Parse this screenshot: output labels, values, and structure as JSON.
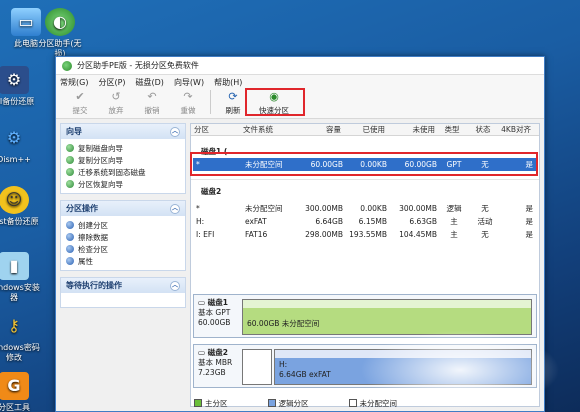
{
  "desktop": {
    "icons": [
      {
        "label": "此电脑",
        "icon": "computer-icon"
      },
      {
        "label": "分区助手(无损)",
        "icon": "partition-assistant-icon"
      },
      {
        "label": "GI备份还原",
        "icon": "ghost-backup-icon"
      },
      {
        "label": "Dism++",
        "icon": "dism-icon"
      },
      {
        "label": "host备份还原",
        "icon": "ghost-icon"
      },
      {
        "label": "Windows安装器",
        "icon": "windows-installer-icon"
      },
      {
        "label": "Windows密码修改",
        "icon": "key-icon"
      },
      {
        "label": "分区工具",
        "icon": "diskgenius-icon"
      }
    ]
  },
  "window": {
    "title": "分区助手PE版 - 无损分区免费软件",
    "menu": [
      "常规(G)",
      "分区(P)",
      "磁盘(D)",
      "向导(W)",
      "帮助(H)"
    ],
    "toolbar": [
      {
        "label": "提交",
        "icon": "check-icon",
        "enabled": false
      },
      {
        "label": "放弃",
        "icon": "undo-icon",
        "enabled": false
      },
      {
        "label": "撤销",
        "icon": "back-icon",
        "enabled": false
      },
      {
        "label": "重做",
        "icon": "redo-icon",
        "enabled": false
      },
      {
        "label": "刷新",
        "icon": "refresh-icon",
        "enabled": true
      },
      {
        "label": "快速分区",
        "icon": "quick-partition-icon",
        "enabled": true
      }
    ]
  },
  "left": {
    "wizard": {
      "title": "向导",
      "items": [
        "复制磁盘向导",
        "复制分区向导",
        "迁移系统到固态磁盘",
        "分区恢复向导"
      ]
    },
    "ops": {
      "title": "分区操作",
      "items": [
        "创建分区",
        "擦除数据",
        "检查分区",
        "属性"
      ]
    },
    "pending": {
      "title": "等待执行的操作"
    }
  },
  "table": {
    "headers": [
      "分区",
      "文件系统",
      "容量",
      "已使用",
      "未使用",
      "类型",
      "状态",
      "4KB对齐"
    ],
    "disk1": {
      "title": "磁盘1 (...",
      "rows": [
        [
          "*",
          "未分配空间",
          "60.00GB",
          "0.00KB",
          "60.00GB",
          "GPT",
          "无",
          "是"
        ]
      ]
    },
    "disk2": {
      "title": "磁盘2",
      "rows": [
        [
          "*",
          "未分配空间",
          "300.00MB",
          "0.00KB",
          "300.00MB",
          "逻辑",
          "无",
          "是"
        ],
        [
          "H:",
          "exFAT",
          "6.64GB",
          "6.15MB",
          "6.63GB",
          "主",
          "活动",
          "是"
        ],
        [
          "I: EFI",
          "FAT16",
          "298.00MB",
          "193.55MB",
          "104.45MB",
          "主",
          "无",
          "是"
        ]
      ]
    }
  },
  "diskmap": {
    "disk1": {
      "name": "磁盘1",
      "type": "基本 GPT",
      "size": "60.00GB",
      "bar": "60.00GB 未分配空间"
    },
    "disk2": {
      "name": "磁盘2",
      "type": "基本 MBR",
      "size": "7.23GB",
      "part_name": "H:",
      "part_desc": "6.64GB exFAT"
    }
  },
  "legend": [
    "主分区",
    "逻辑分区",
    "未分配空间"
  ]
}
